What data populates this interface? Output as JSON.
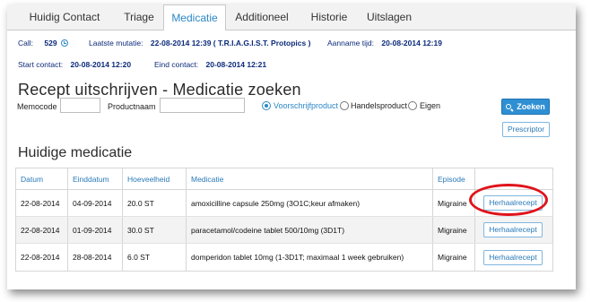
{
  "tabs": [
    {
      "label": "Huidig Contact",
      "active": false
    },
    {
      "label": "Triage",
      "active": false
    },
    {
      "label": "Medicatie",
      "active": true
    },
    {
      "label": "Additioneel",
      "active": false
    },
    {
      "label": "Historie",
      "active": false
    },
    {
      "label": "Uitslagen",
      "active": false
    }
  ],
  "info": {
    "call_label": "Call:",
    "call_value": "529",
    "mutatie_label": "Laatste mutatie:",
    "mutatie_value": "22-08-2014 12:39 ( T.R.I.A.G.I.S.T. Protopics )",
    "aanname_label": "Aanname tijd:",
    "aanname_value": "20-08-2014 12:19",
    "start_label": "Start contact:",
    "start_value": "20-08-2014 12:20",
    "eind_label": "Eind contact:",
    "eind_value": "20-08-2014 12:21"
  },
  "search": {
    "title": "Recept uitschrijven - Medicatie zoeken",
    "memocode_label": "Memocode",
    "memocode_value": "",
    "productnaam_label": "Productnaam",
    "productnaam_value": "",
    "radio_voorschrijf": "Voorschrijfproduct",
    "radio_handels": "Handelsproduct",
    "radio_eigen": "Eigen",
    "selected_radio": "Voorschrijfproduct",
    "zoeken_label": "Zoeken",
    "prescriptor_label": "Prescriptor"
  },
  "current": {
    "title": "Huidige medicatie",
    "columns": [
      "Datum",
      "Einddatum",
      "Hoeveelheid",
      "Medicatie",
      "Episode",
      ""
    ],
    "rows": [
      {
        "datum": "22-08-2014",
        "einddatum": "04-09-2014",
        "hoeveelheid": "20.0 ST",
        "medicatie": "amoxicilline capsule 250mg (3O1C;keur afmaken)",
        "episode": "Migraine",
        "action": "Herhaalrecept"
      },
      {
        "datum": "22-08-2014",
        "einddatum": "01-09-2014",
        "hoeveelheid": "30.0 ST",
        "medicatie": "paracetamol/codeine tablet 500/10mg (3D1T)",
        "episode": "Migraine",
        "action": "Herhaalrecept"
      },
      {
        "datum": "22-08-2014",
        "einddatum": "28-08-2014",
        "hoeveelheid": "6.0 ST",
        "medicatie": "domperidon tablet 10mg (1-3D1T; maximaal 1 week gebruiken)",
        "episode": "Migraine",
        "action": "Herhaalrecept"
      }
    ]
  },
  "colors": {
    "accent": "#2a88c7",
    "primary_button": "#2f8fd3",
    "annotation_circle": "#e0131a"
  }
}
